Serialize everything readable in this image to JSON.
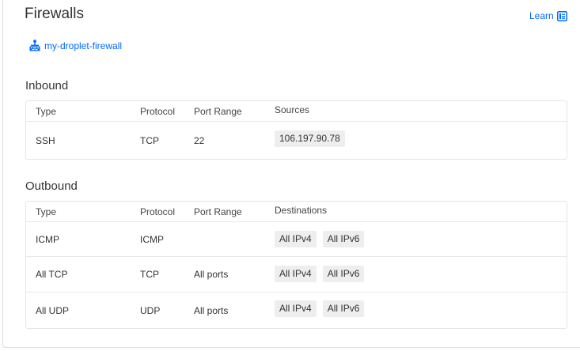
{
  "page": {
    "title": "Firewalls",
    "learn_label": "Learn",
    "firewall_name": "my-droplet-firewall"
  },
  "inbound": {
    "heading": "Inbound",
    "headers": [
      "Type",
      "Protocol",
      "Port Range",
      "Sources"
    ],
    "rows": [
      {
        "type": "SSH",
        "protocol": "TCP",
        "port_range": "22",
        "sources": [
          "106.197.90.78"
        ]
      }
    ]
  },
  "outbound": {
    "heading": "Outbound",
    "headers": [
      "Type",
      "Protocol",
      "Port Range",
      "Destinations"
    ],
    "rows": [
      {
        "type": "ICMP",
        "protocol": "ICMP",
        "port_range": "",
        "destinations": [
          "All IPv4",
          "All IPv6"
        ]
      },
      {
        "type": "All TCP",
        "protocol": "TCP",
        "port_range": "All ports",
        "destinations": [
          "All IPv4",
          "All IPv6"
        ]
      },
      {
        "type": "All UDP",
        "protocol": "UDP",
        "port_range": "All ports",
        "destinations": [
          "All IPv4",
          "All IPv6"
        ]
      }
    ]
  },
  "colors": {
    "link": "#0069ff",
    "text": "#333333",
    "chip_bg": "#eeeeee",
    "border": "#e5e5e5"
  },
  "icons": {
    "learn": "external-doc-icon",
    "firewall": "firewall-icon"
  }
}
